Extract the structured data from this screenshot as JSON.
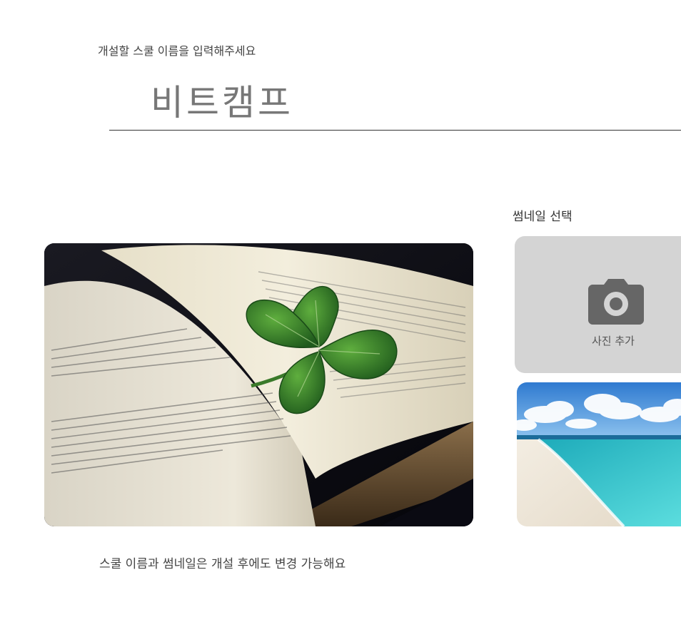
{
  "school_form": {
    "prompt_label": "개설할 스쿨 이름을 입력해주세요",
    "name_value": "비트캠프"
  },
  "thumbnail_section": {
    "title": "썸네일 선택",
    "add_photo_label": "사진 추가",
    "camera_icon": "camera-icon",
    "options": [
      {
        "name": "four-leaf-clover-book",
        "selected": true
      },
      {
        "name": "tropical-beach",
        "selected": false
      }
    ]
  },
  "footer": {
    "note": "스쿨 이름과 썸네일은 개설 후에도 변경 가능해요"
  },
  "colors": {
    "tile_bg": "#d4d4d4",
    "camera": "#666666",
    "underline": "#333333",
    "input_text": "#777777"
  }
}
